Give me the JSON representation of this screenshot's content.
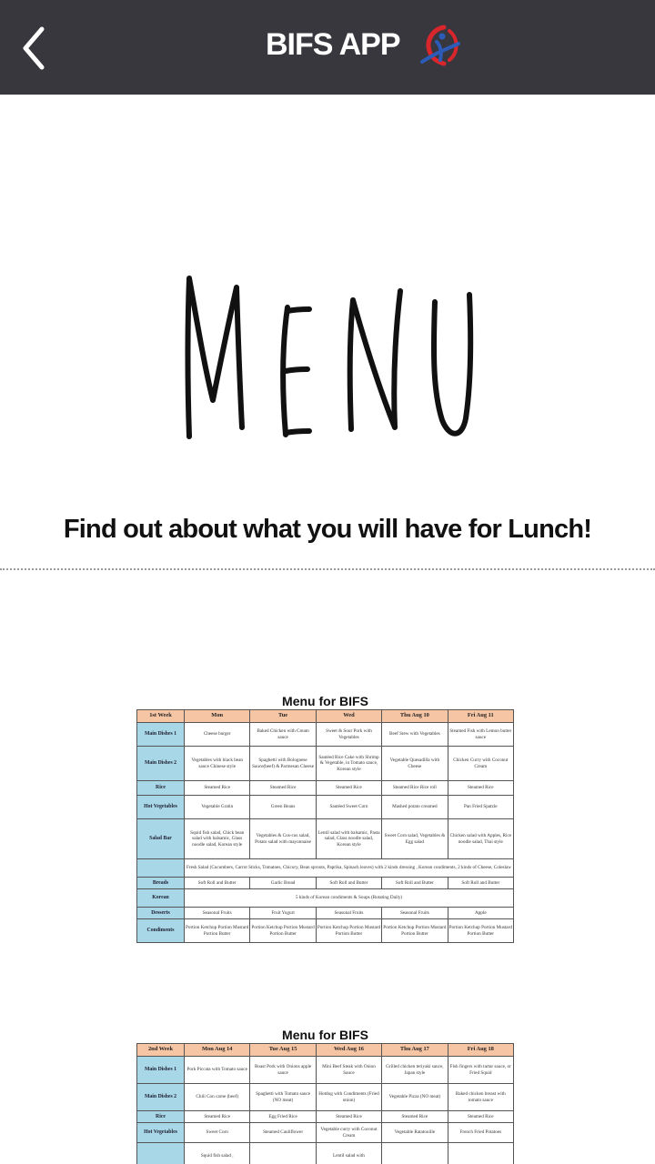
{
  "header": {
    "title": "BIFS APP",
    "back_icon": "chevron-left-icon",
    "logo_icon": "bifs-logo-icon"
  },
  "hero": {
    "text": "MENU"
  },
  "tagline": "Find out about what you will have for Lunch!",
  "menus": [
    {
      "title": "Menu for BIFS",
      "columns": [
        "1st Week",
        "Mon",
        "Tue",
        "Wed",
        "Thu Aug 10",
        "Fri Aug 11"
      ],
      "rows": [
        {
          "label": "Main Dishes 1",
          "cells": [
            "Cheese burger",
            "Baked Chicken with Cream sauce",
            "Sweet & Sour Pork with Vegetables",
            "Beef Stew with Vegetables",
            "Steamed Fish with Lemon butter sauce"
          ]
        },
        {
          "label": "Main Dishes 2",
          "cells": [
            "Vegetables with black bean sauce Chinese style",
            "Spaghetti with Bolognese Sauce(beef) & Parmesan Cheese",
            "Sautéed Rice Cake with Shrimp & Vegetable, in Tomato sauce, Korean style",
            "Vegetable Quesadilla with Cheese",
            "Chicken Curry with Coconut Cream"
          ]
        },
        {
          "label": "Rice",
          "cells": [
            "Steamed Rice",
            "Steamed Rice",
            "Steamed Rice",
            "Steamed Rice Rice roll",
            "Steamed Rice"
          ]
        },
        {
          "label": "Hot Vegetables",
          "cells": [
            "Vegetable Gratin",
            "Green Beans",
            "Sautéed Sweet Corn",
            "Mashed potato creamed",
            "Pan Fried Spatzle"
          ]
        },
        {
          "label": "Salad Bar",
          "cells": [
            "Squid fish salad, Chick bean salad with balsamic, Glass noodle salad, Korean style",
            "Vegetables & Cus-cus salad, Potato salad with mayonnaise",
            "Lentil salad with balsamic, Pasta salad, Glass noodle salad, Korean style",
            "Sweet Corn salad, Vegetables & Egg salad",
            "Chicken salad with Apples, Rice noodle salad, Thai style"
          ]
        },
        {
          "label": "",
          "span": "Fresh Salad (Cucumbers, Carrot Sticks, Tomatoes, Chicory, Bean sprouts, Paprika, Spinach leaves) with 2 kinds dressing , Korean condiments, 2 kinds of Cheese, Coleslaw"
        },
        {
          "label": "Breads",
          "cells": [
            "Soft Roll and Butter",
            "Garlic Bread",
            "Soft Roll and Butter",
            "Soft Roll and Butter",
            "Soft Roll and Butter"
          ]
        },
        {
          "label": "Korean",
          "span": "5 kinds of Korean condiments & Soups (Rotating Daily)"
        },
        {
          "label": "Desserts",
          "cells": [
            "Seasonal Fruits",
            "Fruit Yogurt",
            "Seasonal Fruits",
            "Seasonal Fruits",
            "Apple"
          ]
        },
        {
          "label": "Condiments",
          "cells": [
            "Portion Ketchup Portion Mustard Portion Butter",
            "Portion Ketchup Portion Mustard Portion Butter",
            "Portion Ketchup Portion Mustard Portion Butter",
            "Portion Ketchup Portion Mustard Portion Butter",
            "Portion Ketchup Portion Mustard Portion Butter"
          ]
        }
      ]
    },
    {
      "title": "Menu for BIFS",
      "columns": [
        "2nd Week",
        "Mon Aug 14",
        "Tue Aug 15",
        "Wed Aug 16",
        "Thu Aug 17",
        "Fri Aug 18"
      ],
      "rows": [
        {
          "label": "Main Dishes 1",
          "cells": [
            "Pork Piccata with Tomato sauce",
            "Roast Pork with Onions apple sauce",
            "Mini Beef Steak with Onion Sauce",
            "Grilled chicken teriyaki sauce, Japan style",
            "Fish fingers with tartar sauce, or Fried Squid"
          ]
        },
        {
          "label": "Main Dishes 2",
          "cells": [
            "Chili Con carne (beef)",
            "Spaghetti with Tomato sauce (NO meat)",
            "Hotdog with Condiments (Fried onion)",
            "Vegetable Pizza (NO meat)",
            "Baked chicken breast with tomato sauce"
          ]
        },
        {
          "label": "Rice",
          "cells": [
            "Steamed Rice",
            "Egg Fried Rice",
            "Steamed Rice",
            "Steamed Rice",
            "Steamed Rice"
          ]
        },
        {
          "label": "Hot Vegetables",
          "cells": [
            "Sweet Corn",
            "Steamed Cauliflower",
            "Vegetable curry with Coconut Cream",
            "Vegetable Ratatouille",
            "French Fried Potatoes"
          ]
        },
        {
          "label": "",
          "cells": [
            "Squid fish salad ,",
            "",
            "Lentil salad with",
            "",
            ""
          ]
        }
      ]
    }
  ]
}
